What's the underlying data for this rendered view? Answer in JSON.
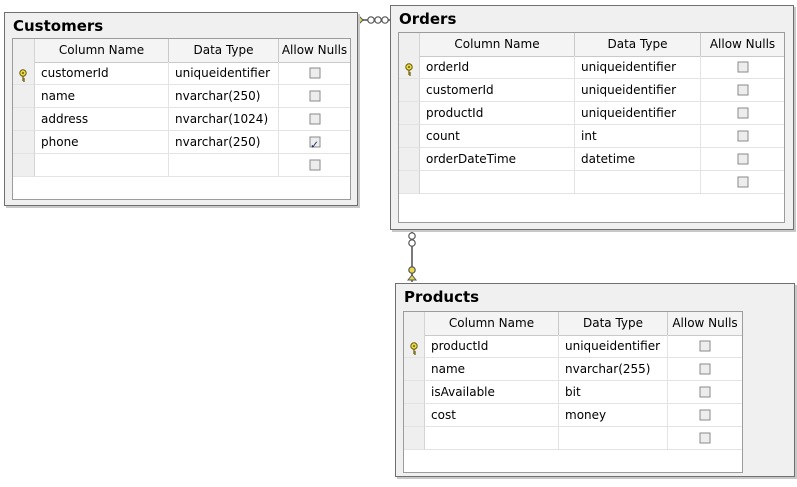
{
  "columns_header": {
    "name": "Column Name",
    "type": "Data Type",
    "nulls": "Allow Nulls"
  },
  "customers": {
    "title": "Customers",
    "rows": [
      {
        "name": "customerId",
        "type": "uniqueidentifier",
        "primary_key": true,
        "allow_nulls": false
      },
      {
        "name": "name",
        "type": "nvarchar(250)",
        "primary_key": false,
        "allow_nulls": false
      },
      {
        "name": "address",
        "type": "nvarchar(1024)",
        "primary_key": false,
        "allow_nulls": false
      },
      {
        "name": "phone",
        "type": "nvarchar(250)",
        "primary_key": false,
        "allow_nulls": true
      },
      {
        "name": "",
        "type": "",
        "primary_key": false,
        "allow_nulls": false
      }
    ]
  },
  "orders": {
    "title": "Orders",
    "rows": [
      {
        "name": "orderId",
        "type": "uniqueidentifier",
        "primary_key": true,
        "allow_nulls": false
      },
      {
        "name": "customerId",
        "type": "uniqueidentifier",
        "primary_key": false,
        "allow_nulls": false
      },
      {
        "name": "productId",
        "type": "uniqueidentifier",
        "primary_key": false,
        "allow_nulls": false
      },
      {
        "name": "count",
        "type": "int",
        "primary_key": false,
        "allow_nulls": false
      },
      {
        "name": "orderDateTime",
        "type": "datetime",
        "primary_key": false,
        "allow_nulls": false
      },
      {
        "name": "",
        "type": "",
        "primary_key": false,
        "allow_nulls": false
      }
    ]
  },
  "products": {
    "title": "Products",
    "rows": [
      {
        "name": "productId",
        "type": "uniqueidentifier",
        "primary_key": true,
        "allow_nulls": false
      },
      {
        "name": "name",
        "type": "nvarchar(255)",
        "primary_key": false,
        "allow_nulls": false
      },
      {
        "name": "isAvailable",
        "type": "bit",
        "primary_key": false,
        "allow_nulls": false
      },
      {
        "name": "cost",
        "type": "money",
        "primary_key": false,
        "allow_nulls": false
      },
      {
        "name": "",
        "type": "",
        "primary_key": false,
        "allow_nulls": false
      }
    ]
  },
  "relationships": [
    {
      "from": "orders.customerId",
      "to": "customers.customerId"
    },
    {
      "from": "orders.productId",
      "to": "products.productId"
    }
  ],
  "colors": {
    "key": "#e8d84a",
    "box": "#f0f0f0",
    "border": "#6f6f6f"
  }
}
